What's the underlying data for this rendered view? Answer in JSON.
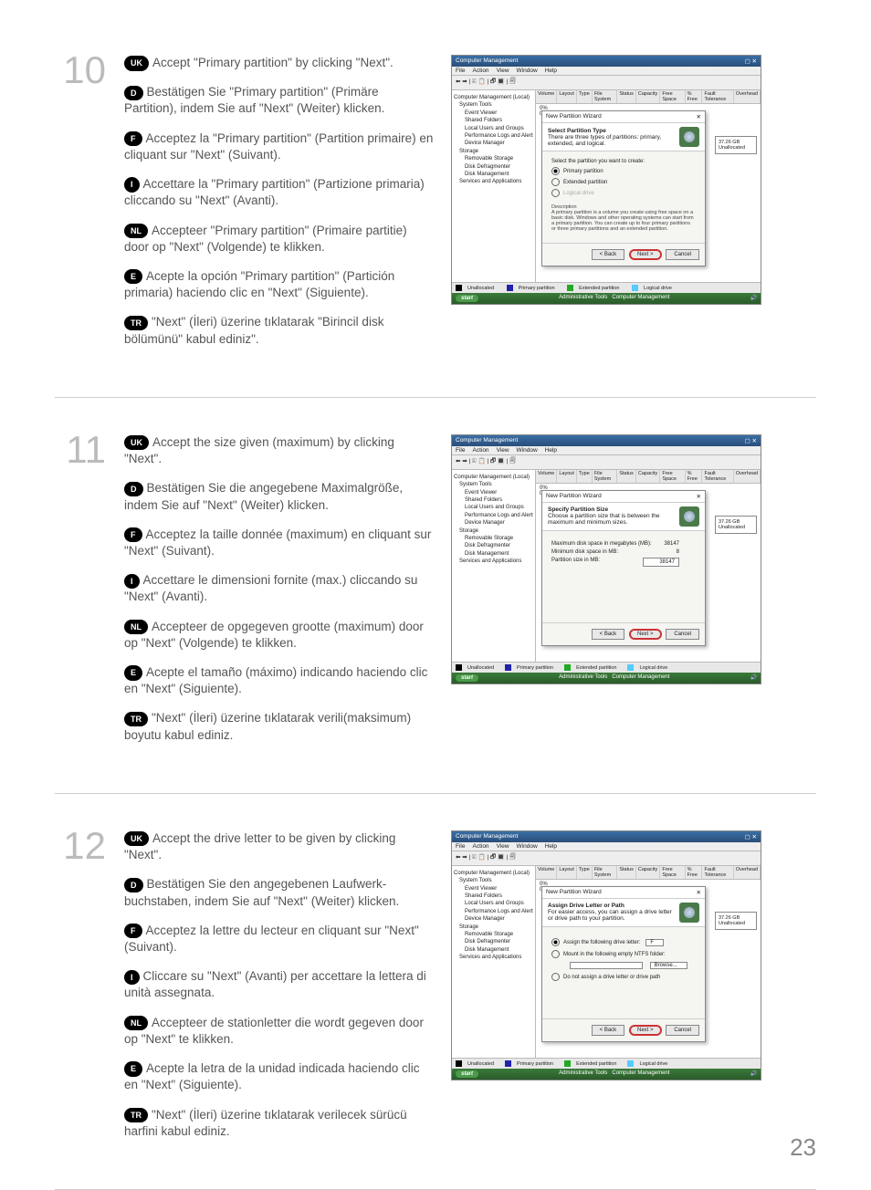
{
  "page_number": "23",
  "steps": [
    {
      "number": "10",
      "langs": {
        "uk": "Accept \"Primary partition\" by clicking \"Next\".",
        "d": "Bestätigen Sie \"Primary partition\" (Primäre Partition), indem Sie auf \"Next\" (Weiter) klicken.",
        "f": "Acceptez la \"Primary partition\" (Partition primaire) en cliquant sur \"Next\" (Suivant).",
        "i": "Accettare la \"Primary partition\" (Partizione primaria) cliccando su \"Next\" (Avanti).",
        "nl": "Accepteer \"Primary partition\" (Primaire partitie) door op \"Next\" (Volgende) te klikken.",
        "e": "Acepte la opción \"Primary partition\" (Partición primaria) haciendo clic en \"Next\" (Siguiente).",
        "tr": "\"Next\" (İleri) üzerine tıklatarak \"Birincil disk bölümünü\" kabul ediniz\"."
      },
      "wizard": {
        "title": "New Partition Wizard",
        "head": "Select Partition Type",
        "sub": "There are three types of partitions: primary, extended, and logical.",
        "prompt": "Select the partition you want to create:",
        "opt_primary": "Primary partition",
        "opt_extended": "Extended partition",
        "opt_logical": "Logical drive",
        "desc_label": "Description",
        "desc": "A primary partition is a volume you create using free space on a basic disk. Windows and other operating systems can start from a primary partition. You can create up to four primary partitions or three primary partitions and an extended partition."
      }
    },
    {
      "number": "11",
      "langs": {
        "uk": "Accept the size given (maximum) by clicking \"Next\".",
        "d": "Bestätigen Sie die angegebene Maximalgröße, indem Sie auf \"Next\" (Weiter) klicken.",
        "f": "Acceptez la taille donnée (maximum) en cliquant sur \"Next\" (Suivant).",
        "i": "Accettare le dimensioni fornite (max.) cliccando su \"Next\" (Avanti).",
        "nl": "Accepteer de opgegeven grootte (maximum) door op \"Next\" (Volgende) te klikken.",
        "e": "Acepte el tamaño (máximo) indicando haciendo clic en \"Next\" (Siguiente).",
        "tr": "\"Next\" (İleri) üzerine tıklatarak verili(maksimum) boyutu kabul ediniz."
      },
      "wizard": {
        "title": "New Partition Wizard",
        "head": "Specify Partition Size",
        "sub": "Choose a partition size that is between the maximum and minimum sizes.",
        "row_max": "Maximum disk space in megabytes (MB):",
        "val_max": "38147",
        "row_min": "Minimum disk space in MB:",
        "val_min": "8",
        "row_size": "Partition size in MB:",
        "val_size": "38147"
      }
    },
    {
      "number": "12",
      "langs": {
        "uk": "Accept the drive letter to be given by clicking \"Next\".",
        "d": "Bestätigen Sie den angegebenen Laufwerk­buchstaben, indem Sie auf \"Next\" (Weiter) klicken.",
        "f": "Acceptez la lettre du lecteur en cliquant sur \"Next\" (Suivant).",
        "i": "Cliccare su \"Next\" (Avanti) per accettare la lettera di unità assegnata.",
        "nl": "Accepteer de stationletter die wordt gegeven door op \"Next\" te klikken.",
        "e": "Acepte la letra de la unidad indicada haciendo clic en \"Next\" (Siguiente).",
        "tr": "\"Next\" (İleri) üzerine tıklatarak verilecek sürücü harfini kabul ediniz."
      },
      "wizard": {
        "title": "New Partition Wizard",
        "head": "Assign Drive Letter or Path",
        "sub": "For easier access, you can assign a drive letter or drive path to your partition.",
        "opt_assign": "Assign the following drive letter:",
        "drive_letter": "F",
        "opt_mount": "Mount in the following empty NTFS folder:",
        "btn_browse": "Browse...",
        "opt_none": "Do not assign a drive letter or drive path"
      }
    }
  ],
  "lang_badges": {
    "uk": "UK",
    "d": "D",
    "f": "F",
    "i": "I",
    "nl": "NL",
    "e": "E",
    "tr": "TR"
  },
  "window": {
    "title": "Computer Management",
    "menu": {
      "file": "File",
      "action": "Action",
      "view": "View",
      "window": "Window",
      "help": "Help"
    },
    "tree": {
      "root": "Computer Management (Local)",
      "system_tools": "System Tools",
      "event_viewer": "Event Viewer",
      "shared_folders": "Shared Folders",
      "local_users": "Local Users and Groups",
      "perf_logs": "Performance Logs and Alerts",
      "device_mgr": "Device Manager",
      "storage": "Storage",
      "removable": "Removable Storage",
      "defrag": "Disk Defragmenter",
      "disk_mgmt": "Disk Management",
      "services": "Services and Applications"
    },
    "cols": {
      "volume": "Volume",
      "layout": "Layout",
      "type": "Type",
      "fs": "File System",
      "status": "Status",
      "capacity": "Capacity",
      "free": "Free Space",
      "pct": "% Free",
      "fault": "Fault Tolerance",
      "overhead": "Overhead"
    },
    "disk_right": {
      "size": "37.26 GB",
      "state": "Unallocated"
    },
    "pct0": "0%",
    "legend": {
      "unalloc": "Unallocated",
      "primary": "Primary partition",
      "extended": "Extended partition",
      "logical": "Logical drive"
    },
    "buttons": {
      "back": "< Back",
      "next": "Next >",
      "cancel": "Cancel"
    },
    "taskbar": {
      "start": "start",
      "item1": "Administrative Tools",
      "item2": "Computer Management"
    }
  }
}
